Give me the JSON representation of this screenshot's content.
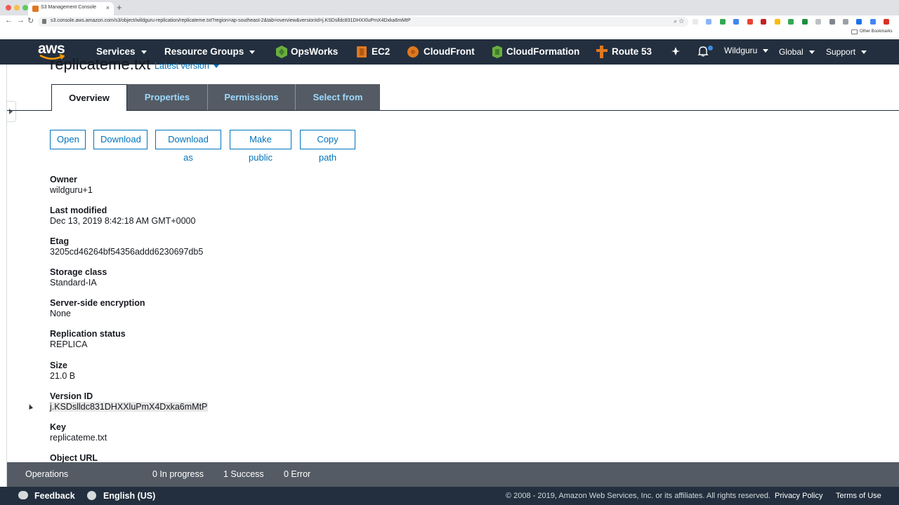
{
  "browser": {
    "tab_title": "S3 Management Console",
    "url": "s3.console.aws.amazon.com/s3/object/wildguru-replication/replicateme.txt?region=ap-southeast-2&tab=overview&versionId=j.KSDslldc831DHXXluPmX4Dxka6mMtP",
    "bookmarks_label": "Other Bookmarks"
  },
  "aws_nav": {
    "logo": "aws",
    "services": "Services",
    "resource_groups": "Resource Groups",
    "pinned": [
      "OpsWorks",
      "EC2",
      "CloudFront",
      "CloudFormation",
      "Route 53"
    ],
    "account": "Wildguru",
    "region": "Global",
    "support": "Support"
  },
  "object": {
    "title": "replicateme.txt",
    "version_label": "Latest version"
  },
  "tabs": [
    "Overview",
    "Properties",
    "Permissions",
    "Select from"
  ],
  "actions": [
    "Open",
    "Download",
    "Download as",
    "Make public",
    "Copy path"
  ],
  "properties": [
    {
      "label": "Owner",
      "value": "wildguru+1"
    },
    {
      "label": "Last modified",
      "value": "Dec 13, 2019 8:42:18 AM GMT+0000"
    },
    {
      "label": "Etag",
      "value": "3205cd46264bf54356addd6230697db5"
    },
    {
      "label": "Storage class",
      "value": "Standard-IA"
    },
    {
      "label": "Server-side encryption",
      "value": "None"
    },
    {
      "label": "Replication status",
      "value": "REPLICA"
    },
    {
      "label": "Size",
      "value": "21.0 B"
    },
    {
      "label": "Version ID",
      "value": "j.KSDslldc831DHXXluPmX4Dxka6mMtP"
    },
    {
      "label": "Key",
      "value": "replicateme.txt"
    },
    {
      "label": "Object URL",
      "value": ""
    }
  ],
  "operations": {
    "label": "Operations",
    "in_progress": "0 In progress",
    "success": "1 Success",
    "error": "0 Error"
  },
  "footer": {
    "feedback": "Feedback",
    "language": "English (US)",
    "copyright": "© 2008 - 2019, Amazon Web Services, Inc. or its affiliates. All rights reserved.",
    "privacy": "Privacy Policy",
    "terms": "Terms of Use"
  },
  "colors": {
    "nav_bg": "#232f3e",
    "tab_inactive_bg": "#545b64",
    "tab_inactive_text": "#9fd9ff",
    "link_blue": "#0073bb",
    "ops_bar_bg": "#545b64",
    "service_orange": "#e0781f",
    "service_green": "#6aae3e"
  }
}
